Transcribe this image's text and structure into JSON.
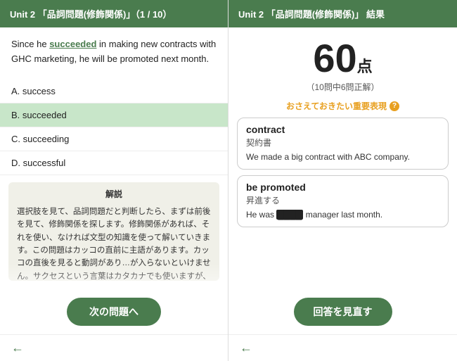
{
  "left": {
    "header": "Unit 2 「品詞問題(修飾関係)」（1 / 10）",
    "question": "Since he succeeded in making new contracts with GHC marketing, he will be promoted next month.",
    "highlight_word": "succeeded",
    "options": [
      {
        "label": "A. success"
      },
      {
        "label": "B. succeeded",
        "selected": true
      },
      {
        "label": "C. succeeding"
      },
      {
        "label": "D. successful"
      }
    ],
    "explanation_title": "解説",
    "explanation_body": "選択肢を見て、品詞問題だと判断したら、まずは前後を見て、修飾関係を探します。修飾関係があれば、それを使い、なければ文型の知識を使って解いていきます。この問題はカッコの直前に主語があります。カッコの直後を見ると動詞があり…が入らないといけません。サクセスという言葉はカタカナでも使いますが、これは",
    "next_button": "次の問題へ",
    "back_arrow": "←"
  },
  "right": {
    "header": "Unit 2 「品詞問題(修飾関係)」 結果",
    "score": "60",
    "score_unit": "点",
    "score_sub": "（10問中6問正解）",
    "important_label": "おさえておきたい重要表現",
    "help_icon": "?",
    "vocab_cards": [
      {
        "word": "contract",
        "meaning": "契約書",
        "example": "We made a big contract with ABC company."
      },
      {
        "word": "be promoted",
        "meaning": "昇進する",
        "example": "He was ████ manager last month."
      }
    ],
    "review_button": "回答を見直す",
    "back_arrow": "←"
  }
}
